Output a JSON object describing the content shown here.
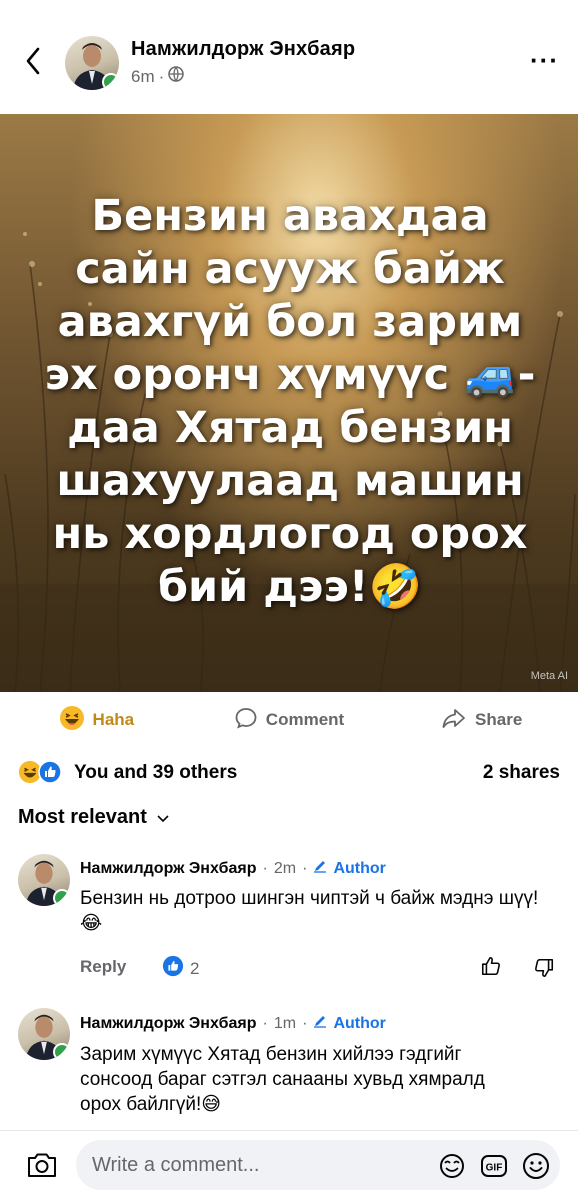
{
  "post": {
    "author": "Намжилдорж Энхбаяр",
    "time": "6m",
    "image_text": "Бензин авахдаа\nсайн асууж байж\nавахгүй бол зарим\nэх оронч хүмүүс 🚙-\nдаа Хятад бензин\nшахуулаад машин\nнь хордлогод орох\nбий дээ!🤣",
    "watermark": "Meta AI"
  },
  "actions": {
    "reaction_label": "Haha",
    "comment_label": "Comment",
    "share_label": "Share"
  },
  "summary": {
    "reactions_text": "You and 39 others",
    "shares_text": "2 shares"
  },
  "sort_label": "Most relevant",
  "comments": [
    {
      "author": "Намжилдорж Энхбаяр",
      "time": "2m",
      "badge": "Author",
      "text": "Бензин нь дотроо шингэн чиптэй ч байж мэднэ шүү!😂",
      "reply_label": "Reply",
      "likes": "2"
    },
    {
      "author": "Намжилдорж Энхбаяр",
      "time": "1m",
      "badge": "Author",
      "text": "Зарим хүмүүс Хятад бензин хийлээ гэдгийг сонсоод бараг сэтгэл санааны хувьд хямралд орох байлгүй!😅"
    }
  ],
  "composer": {
    "placeholder": "Write a comment..."
  },
  "colors": {
    "link_blue": "#1b74e4",
    "muted_gray": "#65676b",
    "online_green": "#31a24c",
    "haha_gold": "#f7b928"
  },
  "icons": [
    "back-chevron-icon",
    "globe-icon",
    "more-icon",
    "haha-emoji-icon",
    "comment-icon",
    "share-icon",
    "like-icon",
    "thumbs-up-icon",
    "thumbs-down-icon",
    "pencil-icon",
    "camera-icon",
    "sticker-icon",
    "gif-icon",
    "emoji-icon",
    "chevron-down-icon"
  ]
}
